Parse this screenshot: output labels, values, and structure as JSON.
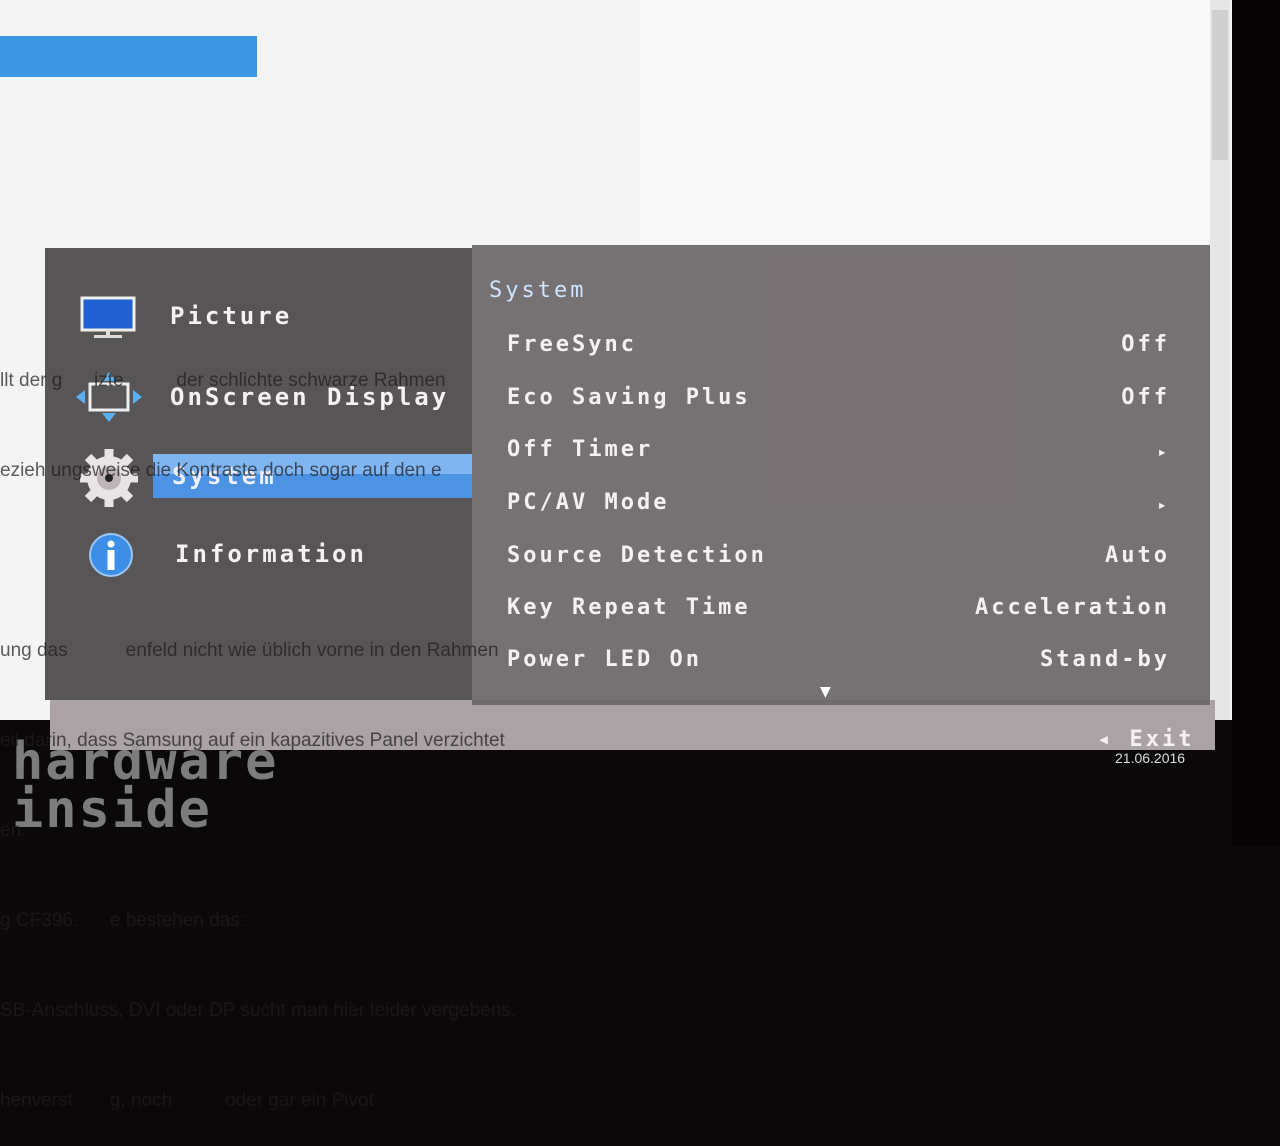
{
  "background_page": {
    "text_lines": [
      "llt der g      izte          der schlichte schwarze Rahmen",
      "ezieh ungsweise die Kontraste doch sogar auf den e",
      "",
      "ung das           enfeld nicht wie üblich vorne in den Rahmen",
      "eil darin, dass Samsung auf ein kapazitives Panel verzichtet",
      "en.",
      "g CF396.      e bestehen das:",
      "SB-Anschluss, DVI oder DP sucht man hier leider vergebens.",
      "henverst       g, noch          oder gar ein Pivot"
    ],
    "date": "21.06.2016"
  },
  "osd": {
    "categories": [
      {
        "label": "Picture",
        "icon": "monitor-icon"
      },
      {
        "label": "OnScreen Display",
        "icon": "move-arrows-icon"
      },
      {
        "label": "System",
        "icon": "gear-icon",
        "selected": true
      },
      {
        "label": "Information",
        "icon": "info-icon"
      }
    ],
    "section_title": "System",
    "items": [
      {
        "label": "FreeSync",
        "value": "Off"
      },
      {
        "label": "Eco Saving Plus",
        "value": "Off"
      },
      {
        "label": "Off Timer",
        "value": "▸"
      },
      {
        "label": "PC/AV Mode",
        "value": "▸"
      },
      {
        "label": "Source Detection",
        "value": "Auto"
      },
      {
        "label": "Key Repeat Time",
        "value": "Acceleration"
      },
      {
        "label": "Power LED On",
        "value": "Stand-by"
      }
    ],
    "more_indicator": "▼",
    "exit_label": "◂ Exit",
    "accent_color": "#4d93e3"
  },
  "watermark": {
    "text": "hardware inside"
  }
}
